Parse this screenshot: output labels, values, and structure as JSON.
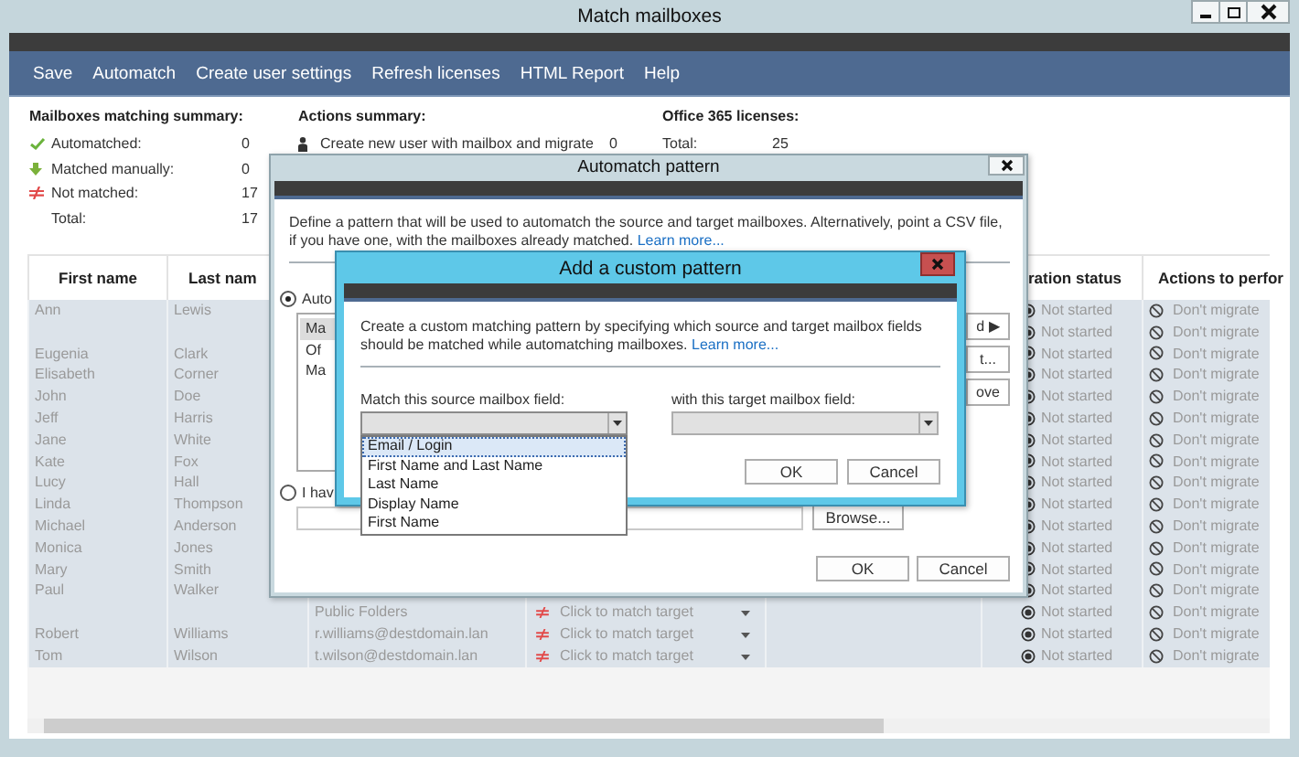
{
  "window": {
    "title": "Match mailboxes"
  },
  "menu": [
    "Save",
    "Automatch",
    "Create user settings",
    "Refresh licenses",
    "HTML Report",
    "Help"
  ],
  "matching_summary": {
    "title": "Mailboxes matching summary:",
    "items": [
      {
        "kind": "automatched",
        "label": "Automatched:",
        "value": "0"
      },
      {
        "kind": "manual",
        "label": "Matched manually:",
        "value": "0"
      },
      {
        "kind": "not_matched",
        "label": "Not matched:",
        "value": "17"
      },
      {
        "kind": "total",
        "label": "Total:",
        "value": "17"
      }
    ]
  },
  "actions_summary": {
    "title": "Actions summary:",
    "items": [
      {
        "label": "Create new user with mailbox and migrate",
        "value": "0"
      }
    ]
  },
  "licenses_summary": {
    "title": "Office 365 licenses:",
    "items": [
      {
        "label": "Total:",
        "value": "25"
      }
    ]
  },
  "table": {
    "columns": {
      "first_name": "First name",
      "last_name": "Last nam",
      "status": "ration status",
      "action": "Actions to perfor"
    },
    "rows": [
      {
        "first_name": "Ann",
        "last_name": "Lewis",
        "status": "Not started",
        "action": "Don't migrate"
      },
      {
        "status": "Not started",
        "action": "Don't migrate"
      },
      {
        "first_name": "Eugenia",
        "last_name": "Clark",
        "status": "Not started",
        "action": "Don't migrate"
      },
      {
        "first_name": "Elisabeth",
        "last_name": "Corner",
        "status": "Not started",
        "action": "Don't migrate"
      },
      {
        "first_name": "John",
        "last_name": "Doe",
        "status": "Not started",
        "action": "Don't migrate"
      },
      {
        "first_name": "Jeff",
        "last_name": "Harris",
        "status": "Not started",
        "action": "Don't migrate"
      },
      {
        "first_name": "Jane",
        "last_name": "White",
        "status": "Not started",
        "action": "Don't migrate"
      },
      {
        "first_name": "Kate",
        "last_name": "Fox",
        "status": "Not started",
        "action": "Don't migrate"
      },
      {
        "first_name": "Lucy",
        "last_name": "Hall",
        "status": "Not started",
        "action": "Don't migrate"
      },
      {
        "first_name": "Linda",
        "last_name": "Thompson",
        "status": "Not started",
        "action": "Don't migrate"
      },
      {
        "first_name": "Michael",
        "last_name": "Anderson",
        "status": "Not started",
        "action": "Don't migrate"
      },
      {
        "first_name": "Monica",
        "last_name": "Jones",
        "status": "Not started",
        "action": "Don't migrate"
      },
      {
        "first_name": "Mary",
        "last_name": "Smith",
        "status": "Not started",
        "action": "Don't migrate"
      },
      {
        "first_name": "Paul",
        "last_name": "Walker",
        "status": "Not started",
        "action": "Don't migrate"
      },
      {
        "email": "Public Folders",
        "match": "Click to match target",
        "status": "Not started",
        "action": "Don't migrate"
      },
      {
        "first_name": "Robert",
        "last_name": "Williams",
        "email": "r.williams@destdomain.lan",
        "match": "Click to match target",
        "status": "Not started",
        "action": "Don't migrate"
      },
      {
        "first_name": "Tom",
        "last_name": "Wilson",
        "email": "t.wilson@destdomain.lan",
        "match": "Click to match target",
        "status": "Not started",
        "action": "Don't migrate"
      }
    ]
  },
  "automatch_dialog": {
    "title": "Automatch pattern",
    "description": "Define a pattern that will be used to automatch the source and target mailboxes. Alternatively, point a CSV file, if you have one, with the mailboxes already matched.",
    "link": "Learn more...",
    "options": [
      {
        "label": "Auto",
        "selected": true
      },
      {
        "label": "I hav",
        "selected": false
      }
    ],
    "patterns": [
      {
        "label": "Ma",
        "selected": true
      },
      {
        "label": "Of",
        "selected": false
      },
      {
        "label": "Ma",
        "selected": false
      }
    ],
    "side_buttons": [
      "d ▶",
      "t...",
      "ove"
    ],
    "browse_button": "Browse...",
    "buttons": [
      "OK",
      "Cancel"
    ]
  },
  "custom_pattern_dialog": {
    "title": "Add a custom pattern",
    "description": "Create a custom matching pattern by specifying which source and target mailbox fields should be matched while automatching mailboxes.",
    "link": "Learn more...",
    "source": {
      "label": "Match this source mailbox field:",
      "expanded": true,
      "options": [
        {
          "label": "Email / Login",
          "selected": true
        },
        {
          "label": "First Name and Last Name",
          "selected": false
        },
        {
          "label": "Last Name",
          "selected": false
        },
        {
          "label": "Display Name",
          "selected": false
        },
        {
          "label": "First Name",
          "selected": false
        }
      ]
    },
    "target": {
      "label": "with this target mailbox field:",
      "expanded": false
    },
    "buttons": [
      "OK",
      "Cancel"
    ]
  }
}
